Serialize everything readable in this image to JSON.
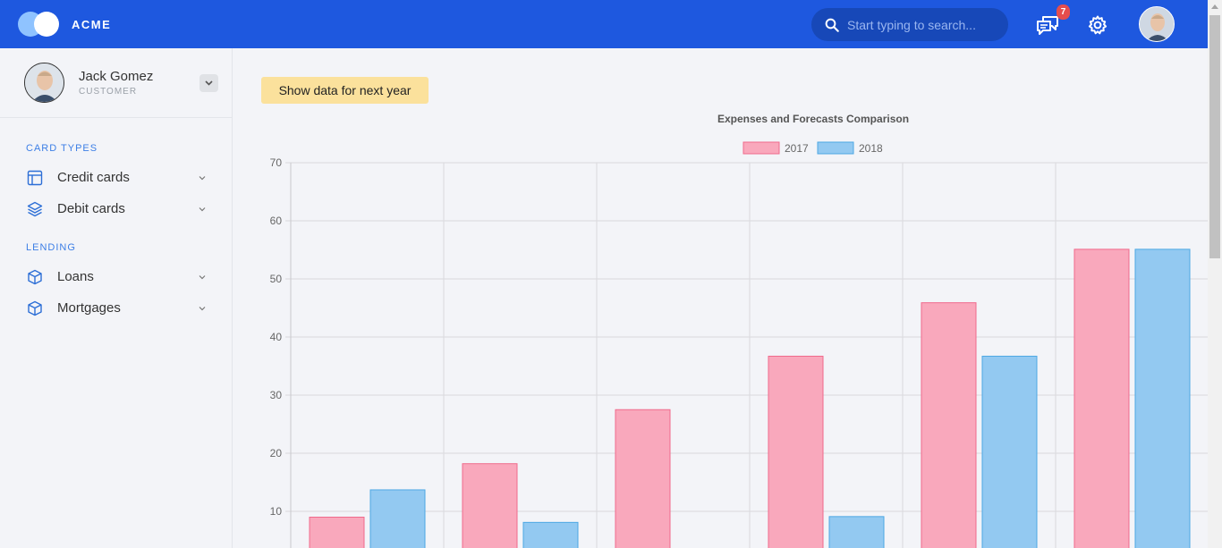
{
  "app": {
    "brand": "ACME"
  },
  "header": {
    "search_placeholder": "Start typing to search...",
    "notifications_count": "7"
  },
  "user": {
    "name": "Jack Gomez",
    "role": "CUSTOMER"
  },
  "sidebar": {
    "sections": [
      {
        "title": "CARD TYPES",
        "items": [
          {
            "label": "Credit cards",
            "icon": "layout-icon"
          },
          {
            "label": "Debit cards",
            "icon": "layers-icon"
          }
        ]
      },
      {
        "title": "LENDING",
        "items": [
          {
            "label": "Loans",
            "icon": "box-icon"
          },
          {
            "label": "Mortgages",
            "icon": "box-icon"
          }
        ]
      }
    ]
  },
  "main": {
    "next_year_button": "Show data for next year"
  },
  "colors": {
    "accent": "#1e58df",
    "series_2017": "#f9a8bc",
    "series_2018": "#93c9f1",
    "button": "#fbe19c"
  },
  "chart_data": {
    "type": "bar",
    "title": "Expenses and Forecasts Comparison",
    "categories": [
      "",
      "",
      "",
      "",
      "",
      ""
    ],
    "series": [
      {
        "name": "2017",
        "values": [
          9,
          18.2,
          27.5,
          36.7,
          45.9,
          55.1
        ]
      },
      {
        "name": "2018",
        "values": [
          13.7,
          8.1,
          0,
          9.1,
          36.7,
          55.1
        ]
      }
    ],
    "ylim": [
      0,
      70
    ],
    "yticks": [
      "10",
      "20",
      "30",
      "40",
      "50",
      "60",
      "70"
    ],
    "grid": true,
    "legend": "top-center"
  }
}
